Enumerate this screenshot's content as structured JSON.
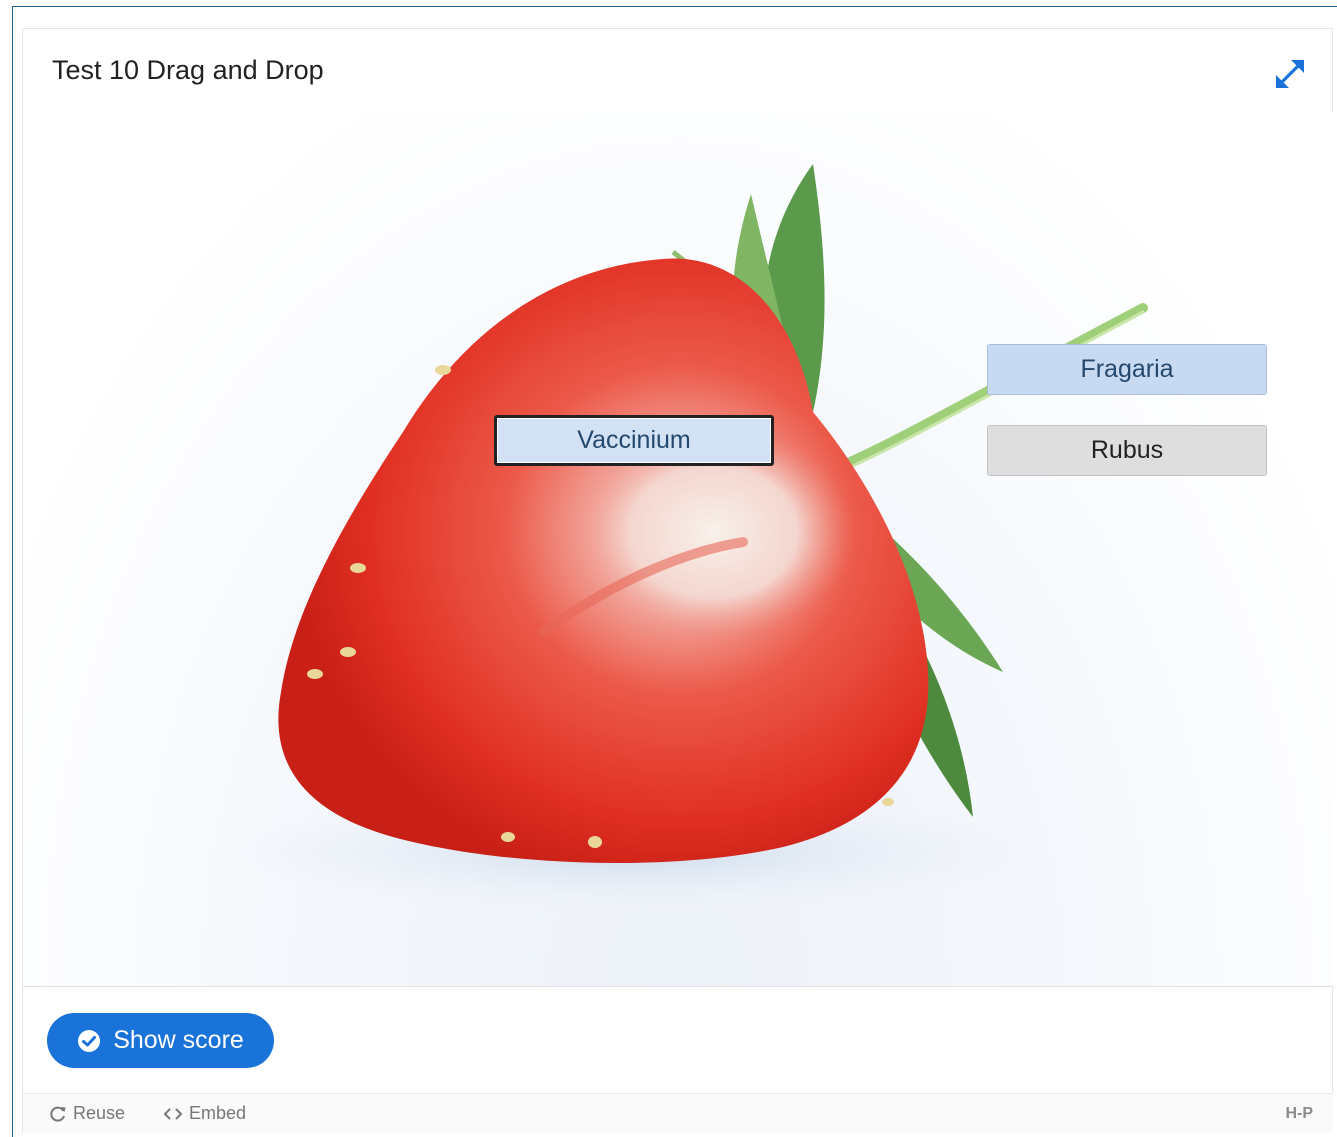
{
  "header": {
    "title": "Test 10 Drag and Drop",
    "fullscreen_icon": "expand-arrows-icon"
  },
  "task": {
    "image": "strawberry-cross-section",
    "drop_zones": [
      {
        "label": "Vaccinium",
        "state": "focused"
      },
      {
        "label": "Fragaria",
        "state": "highlighted"
      },
      {
        "label": "Rubus",
        "state": "default"
      }
    ]
  },
  "actions": {
    "show_score_label": "Show score",
    "show_score_icon": "check-circle-icon"
  },
  "footer": {
    "reuse_label": "Reuse",
    "reuse_icon": "refresh-icon",
    "embed_label": "Embed",
    "embed_icon": "code-icon",
    "logo_text": "H-P"
  },
  "colors": {
    "accent": "#1a73d9",
    "zone_highlight": "#c8daf1",
    "zone_default": "#dedede",
    "frame_border": "#1f5f8e"
  }
}
